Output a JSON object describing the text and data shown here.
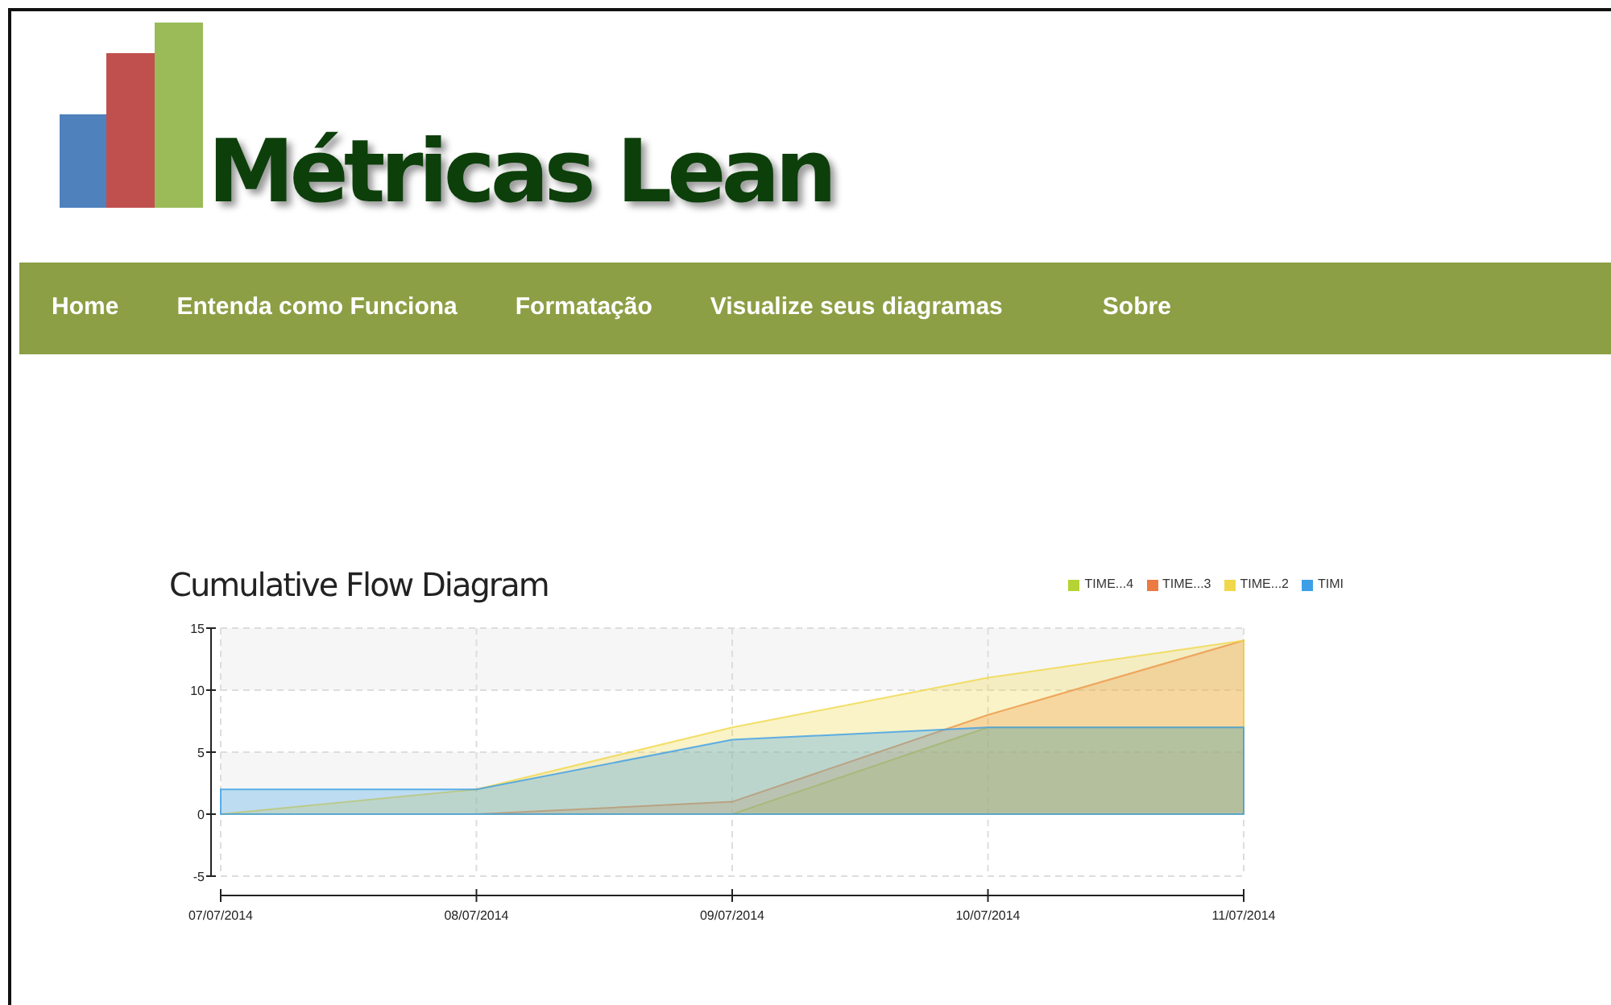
{
  "logo": {
    "text": "Métricas Lean"
  },
  "nav": {
    "items": [
      {
        "label": "Home"
      },
      {
        "label": "Entenda como Funciona"
      },
      {
        "label": "Formatação"
      },
      {
        "label": "Visualize seus diagramas"
      },
      {
        "label": "Sobre"
      }
    ]
  },
  "chart": {
    "chart_data": {
      "type": "area",
      "title": "Cumulative Flow Diagram",
      "categories": [
        "07/07/2014",
        "08/07/2014",
        "09/07/2014",
        "10/07/2014",
        "11/07/2014"
      ],
      "ylim": [
        -5,
        15
      ],
      "yticks": [
        -5,
        0,
        5,
        10,
        15
      ],
      "stacked": false,
      "grid": true,
      "legend": true,
      "series": [
        {
          "name": "TIME...4",
          "color": "#b5d334",
          "values": [
            null,
            null,
            0,
            7,
            7
          ]
        },
        {
          "name": "TIME...3",
          "color": "#ec7a43",
          "values": [
            null,
            0,
            1,
            8,
            14
          ]
        },
        {
          "name": "TIME...2",
          "color": "#f0d84a",
          "values": [
            0,
            2,
            7,
            11,
            14
          ]
        },
        {
          "name": "TIMI",
          "color": "#3d9fe6",
          "values": [
            2,
            2,
            6,
            7,
            7
          ]
        }
      ]
    }
  }
}
